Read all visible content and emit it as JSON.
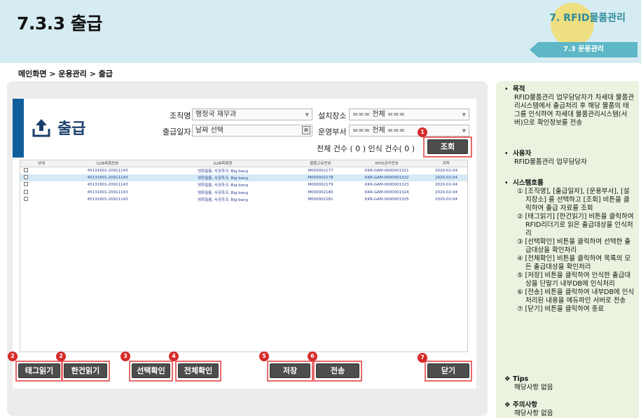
{
  "header": {
    "title": "7.3.3 출급",
    "section": "7. RFID물품관리",
    "subsection": "7.3 운용관리"
  },
  "breadcrumb": "메인화면 > 운용관리 > 출급",
  "screen": {
    "heading": "출급",
    "filters": {
      "org_label": "조직명",
      "org_value": "행정국 재무과",
      "location_label": "설치장소",
      "location_value": "=== 전체 ===",
      "date_label": "출급일자",
      "date_placeholder": "날짜 선택",
      "dept_label": "운영부서",
      "dept_value": "=== 전체 ==="
    },
    "count_text": "전체 건수 ( 0 )  인식 건수( 0 )",
    "search_button": "조회",
    "table": {
      "headers": [
        "상태",
        "G2B목록번호",
        "G2B목록명",
        "물품고유번호",
        "RFID관리번호",
        "취득"
      ],
      "rows": [
        [
          "",
          "45131601-20911143",
          "영화필름, 사공하크, Big bang",
          "M000002177",
          "KKR-GAM-0000001321",
          "2020-02-04"
        ],
        [
          "",
          "45131601-20911143",
          "영화필름, 사공하크, Big bang",
          "M000002178",
          "KKR-GAM-0000001322",
          "2020-02-04"
        ],
        [
          "",
          "45131601-20911143",
          "영화필름, 사공하크, Big bang",
          "M000002179",
          "KKR-GAM-0000001323",
          "2020-02-04"
        ],
        [
          "",
          "45131601-20911143",
          "영화필름, 사공하크, Big bang",
          "M000002180",
          "KKR-GAM-0000001324",
          "2020-02-04"
        ],
        [
          "",
          "45131601-20911143",
          "영화필름, 사공하크, Big bang",
          "M000002181",
          "KKR-GAM-0000001325",
          "2020-02-04"
        ]
      ]
    },
    "buttons": {
      "tag_read": "태그읽기",
      "single_read": "한건읽기",
      "confirm_selected": "선택확인",
      "confirm_all": "전체확인",
      "save": "저장",
      "send": "전송",
      "close": "닫기"
    },
    "badges": [
      "1",
      "2",
      "2",
      "3",
      "4",
      "5",
      "6",
      "7"
    ]
  },
  "info": {
    "purpose_head": "목적",
    "purpose_body": "RFID물품관리 업무담당자가 차세대 물품관리시스템에서 출급처리 후 해당 물품의 태그를 인식하여 차세대 물품관리시스템(서버)으로 확인정보를 전송",
    "user_head": "사용자",
    "user_body": "RFID물품관리 업무담당자",
    "flow_head": "시스템흐름",
    "steps": [
      "① [조직명], [출급일자], [운용부서], [설치장소] 를 선택하고 [조회] 비튼을 클릭하여 출급 자료를 조회",
      "② [태그읽기] [한건읽기] 비튼을 클릭하여 RFID리더기로 읽은 출급대상을 인식처리",
      "③ [선택확인] 비튼을 클릭하여 선택한 출급대상을 확인처리",
      "④ [전체확인] 비튼을 클릭하여 목록의 모든 출급대상을 확인처리",
      "⑤ [저장] 비튼을 클릭하여 인식한 출급대상을 단말기 내부DB에 인식처리",
      "⑥ [전송] 비튼을 클릭하여 내부DB에 인식처리된 내용을 에듀파인 서버로 전송",
      "⑦ [닫기] 비튼을 클릭하여 종료"
    ],
    "tips_head": "Tips",
    "tips_body": "해당사항 없음",
    "caution_head": "주의사항",
    "caution_body": "해당사항 없음"
  },
  "colors": {
    "header_bg": "#d6ecf3",
    "accent": "#0f5d9a",
    "ribbon": "#5db7c6",
    "badge": "#d62b2b",
    "highlight_box": "#e86a6a",
    "info_bg": "#eaf3df"
  }
}
